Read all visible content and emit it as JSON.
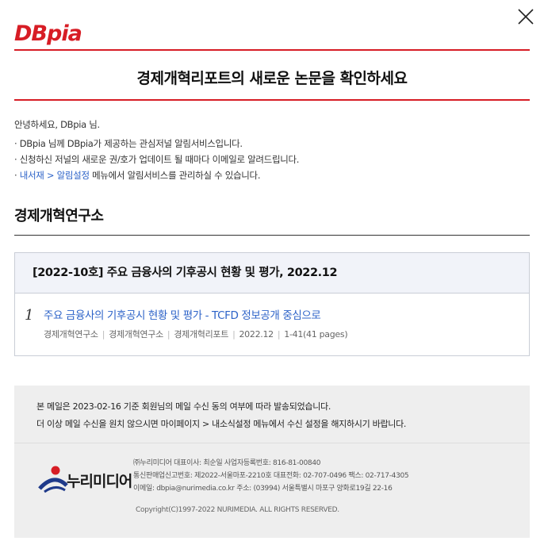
{
  "brand": {
    "logo_text": "DBpia",
    "accent_color": "#d71d25"
  },
  "close_icon": "close-icon",
  "headline": "경제개혁리포트의 새로운 논문을 확인하세요",
  "intro": {
    "greeting": "안녕하세요, DBpia 님.",
    "line1": "· DBpia 님께 DBpia가 제공하는 관심저널 알림서비스입니다.",
    "line2": "· 신청하신 저널의 새로운 권/호가 업데이트 될 때마다 이메일로 알려드립니다.",
    "line3_prefix": "· ",
    "line3_link": "내서재 > 알림설정",
    "line3_suffix": " 메뉴에서 알림서비스를 관리하실 수 있습니다."
  },
  "journal_name": "경제개혁연구소",
  "issue": {
    "title": "[2022-10호] 주요 금융사의 기후공시 현황 및 평가, 2022.12",
    "papers": [
      {
        "number": "1",
        "title": "주요 금융사의 기후공시 현황 및 평가 - TCFD 정보공개 중심으로",
        "author": "경제개혁연구소",
        "publisher": "경제개혁연구소",
        "journal": "경제개혁리포트",
        "date": "2022.12",
        "pages": "1-41(41 pages)"
      }
    ]
  },
  "footer": {
    "notice1": "본 메일은 2023-02-16 기준 회원님의 메일 수신 동의 여부에 따라 발송되었습니다.",
    "notice2": "더 이상 메일 수신을 원치 않으시면 마이페이지 > 내소식설정 메뉴에서 수신 설정을 해지하시기 바랍니다.",
    "company_logo_text": "누리미디어",
    "company_line1": "㈜누리미디어 대표이사: 최순일 사업자등록번호: 816-81-00840",
    "company_line2": "통신판매업신고번호: 제2022-서울마포-2210호 대표전화: 02-707-0496 팩스: 02-717-4305",
    "company_line3": "이메일: dbpia@nurimedia.co.kr 주소: (03994) 서울특별시 마포구 양화로19길 22-16",
    "copyright": "Copyright(C)1997-2022 NURIMEDIA. ALL RIGHTS RESERVED."
  }
}
